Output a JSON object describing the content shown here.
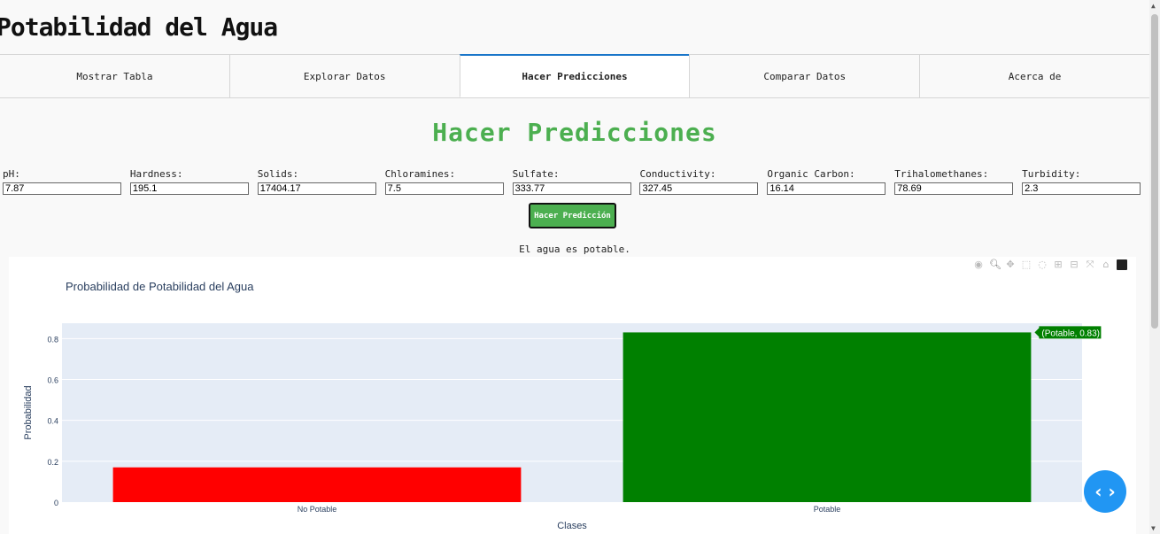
{
  "app": {
    "title": "Potabilidad del Agua"
  },
  "tabs": [
    {
      "label": "Mostrar Tabla",
      "active": false
    },
    {
      "label": "Explorar Datos",
      "active": false
    },
    {
      "label": "Hacer Predicciones",
      "active": true
    },
    {
      "label": "Comparar Datos",
      "active": false
    },
    {
      "label": "Acerca de",
      "active": false
    }
  ],
  "section": {
    "title": "Hacer Predicciones"
  },
  "fields": [
    {
      "label": "pH:",
      "value": "7.87"
    },
    {
      "label": "Hardness:",
      "value": "195.1"
    },
    {
      "label": "Solids:",
      "value": "17404.17"
    },
    {
      "label": "Chloramines:",
      "value": "7.5"
    },
    {
      "label": "Sulfate:",
      "value": "333.77"
    },
    {
      "label": "Conductivity:",
      "value": "327.45"
    },
    {
      "label": "Organic Carbon:",
      "value": "16.14"
    },
    {
      "label": "Trihalomethanes:",
      "value": "78.69"
    },
    {
      "label": "Turbidity:",
      "value": "2.3"
    }
  ],
  "predict_button": "Hacer Predicción",
  "result_text": "El agua es potable.",
  "modebar_icons": [
    "camera-icon",
    "zoom-icon",
    "pan-icon",
    "box-select-icon",
    "lasso-icon",
    "zoom-in-icon",
    "zoom-out-icon",
    "autoscale-icon",
    "home-icon",
    "plotly-logo-icon"
  ],
  "chart_data": {
    "type": "bar",
    "title": "Probabilidad de Potabilidad del Agua",
    "xlabel": "Clases",
    "ylabel": "Probabilidad",
    "categories": [
      "No Potable",
      "Potable"
    ],
    "values": [
      0.17,
      0.83
    ],
    "colors": [
      "#ff0000",
      "#008000"
    ],
    "ylim": [
      0,
      0.875
    ],
    "yticks": [
      0,
      0.2,
      0.4,
      0.6,
      0.8
    ],
    "ytick_labels": [
      "0",
      "0.2",
      "0.4",
      "0.6",
      "0.8"
    ],
    "hover_label": "(Potable, 0.83)",
    "plot_bg": "#e5ecf6",
    "grid": true
  }
}
